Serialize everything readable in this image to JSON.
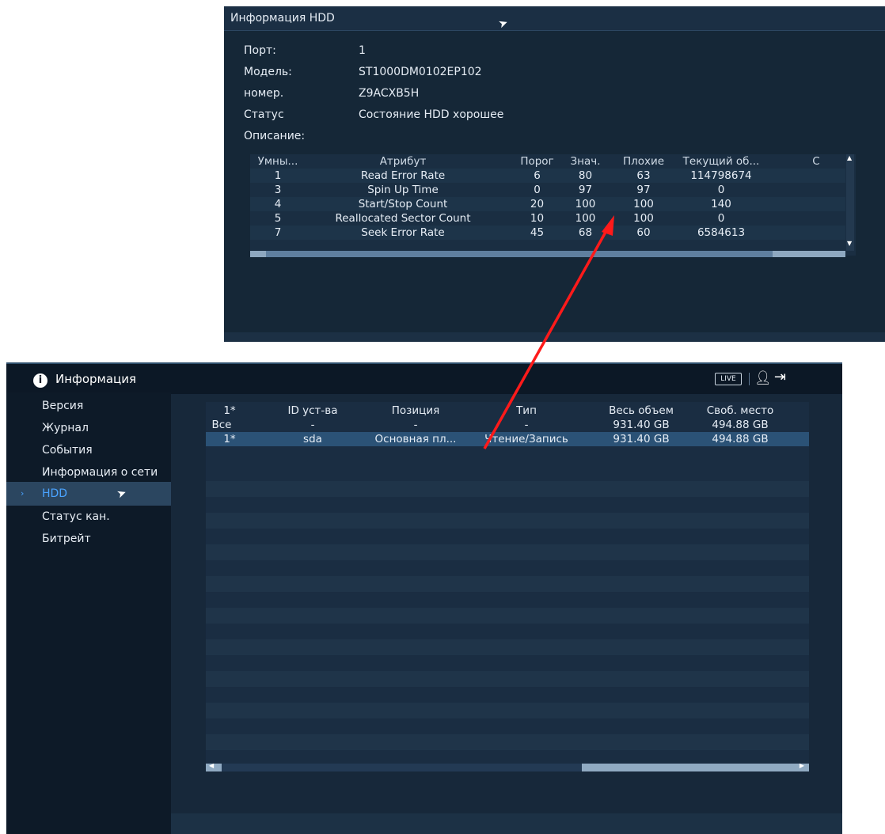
{
  "dialog": {
    "title": "Информация HDD",
    "fields": [
      {
        "label": "Порт:",
        "value": "1"
      },
      {
        "label": "Модель:",
        "value": "ST1000DM0102EP102"
      },
      {
        "label": "номер.",
        "value": "Z9ACXB5H"
      },
      {
        "label": "Статус",
        "value": "Состояние HDD хорошее"
      },
      {
        "label": "Описание:",
        "value": ""
      }
    ],
    "smart_table": {
      "headers": [
        "Умны...",
        "Атрибут",
        "Порог",
        "Знач.",
        "Плохие",
        "Текущий об...",
        "С"
      ],
      "rows": [
        [
          "1",
          "Read Error Rate",
          "6",
          "80",
          "63",
          "114798674"
        ],
        [
          "3",
          "Spin Up Time",
          "0",
          "97",
          "97",
          "0"
        ],
        [
          "4",
          "Start/Stop Count",
          "20",
          "100",
          "100",
          "140"
        ],
        [
          "5",
          "Reallocated Sector Count",
          "10",
          "100",
          "100",
          "0"
        ],
        [
          "7",
          "Seek Error Rate",
          "45",
          "68",
          "60",
          "6584613"
        ]
      ]
    }
  },
  "main": {
    "header_title": "Информация",
    "live_label": "LIVE",
    "sidebar": [
      {
        "label": "Версия"
      },
      {
        "label": "Журнал"
      },
      {
        "label": "События"
      },
      {
        "label": "Информация о сети"
      },
      {
        "label": "HDD"
      },
      {
        "label": "Статус кан."
      },
      {
        "label": "Битрейт"
      }
    ],
    "hdd_table": {
      "headers": [
        "1*",
        "ID уст-ва",
        "Позиция",
        "Тип",
        "Весь объем",
        "Своб. место"
      ],
      "rows": [
        [
          "Все",
          "-",
          "-",
          "-",
          "931.40 GB",
          "494.88 GB"
        ],
        [
          "1*",
          "sda",
          "Основная пл...",
          "Чтение/Запись",
          "931.40 GB",
          "494.88 GB"
        ]
      ]
    }
  },
  "icons": {
    "header": "info-circle-icon",
    "user": "user-icon",
    "exit": "logout-icon",
    "cursor": "mouse-pointer-icon"
  },
  "colors": {
    "accent": "#4aa3ff",
    "annotation_arrow": "#ff1a1a",
    "panel_bg": "#17283a",
    "sidebar_bg": "#0d1a28"
  }
}
